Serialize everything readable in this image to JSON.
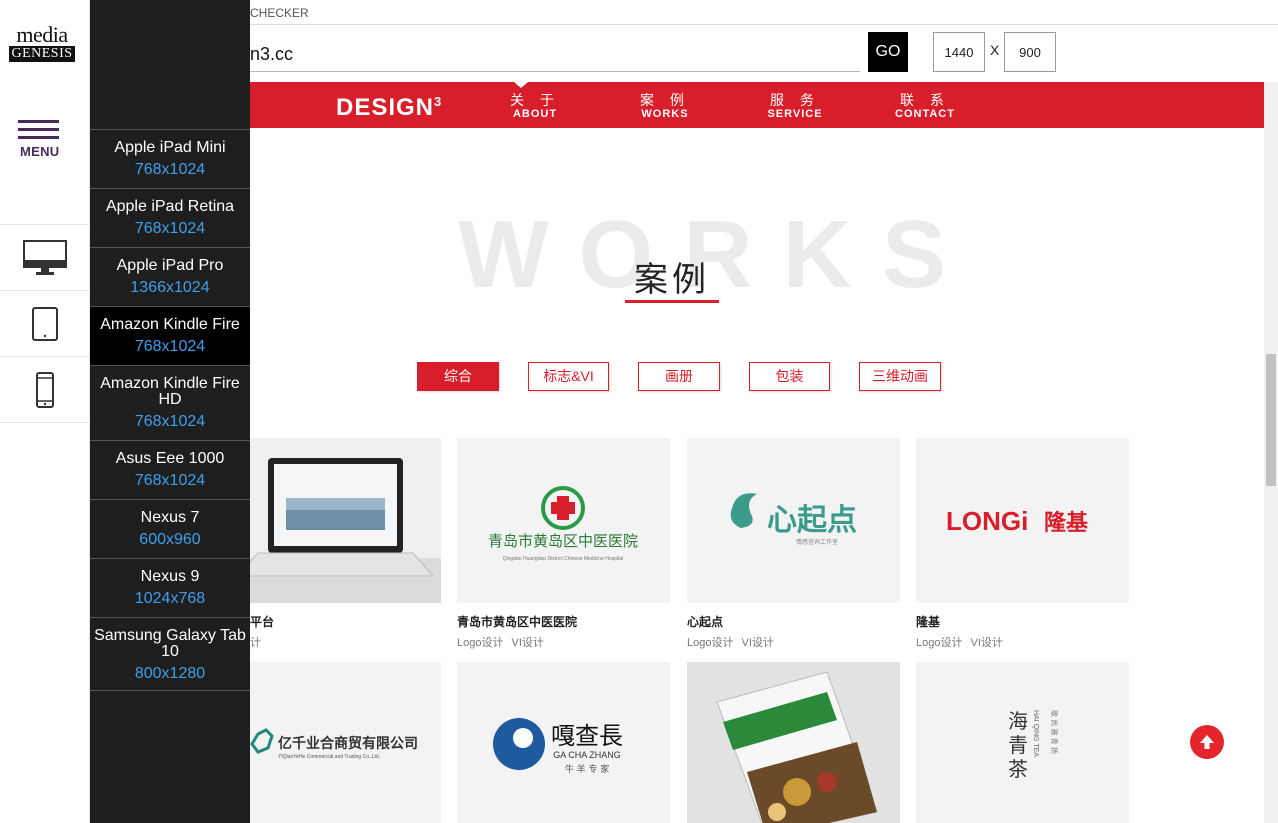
{
  "rail": {
    "logo_line1": "media",
    "logo_line2": "GENESIS",
    "menu_label": "MENU"
  },
  "devices": [
    {
      "name": "Apple iPad Mini",
      "size": "768x1024",
      "active": false
    },
    {
      "name": "Apple iPad Retina",
      "size": "768x1024",
      "active": false
    },
    {
      "name": "Apple iPad Pro",
      "size": "1366x1024",
      "active": false
    },
    {
      "name": "Amazon Kindle Fire",
      "size": "768x1024",
      "active": true
    },
    {
      "name": "Amazon Kindle Fire HD",
      "size": "768x1024",
      "active": false
    },
    {
      "name": "Asus Eee 1000",
      "size": "768x1024",
      "active": false
    },
    {
      "name": "Nexus 7",
      "size": "600x960",
      "active": false
    },
    {
      "name": "Nexus 9",
      "size": "1024x768",
      "active": false
    },
    {
      "name": "Samsung Galaxy Tab 10",
      "size": "800x1280",
      "active": false
    }
  ],
  "toolbar": {
    "checker_label": "CHECKER",
    "url_value": "n3.cc",
    "go_label": "GO",
    "width_value": "1440",
    "x_label": "X",
    "height_value": "900"
  },
  "site": {
    "brand": "DESIGN",
    "brand_sup": "3",
    "nav": [
      {
        "zh": "关 于",
        "en": "ABOUT"
      },
      {
        "zh": "案 例",
        "en": "WORKS"
      },
      {
        "zh": "服 务",
        "en": "SERVICE"
      },
      {
        "zh": "联 系",
        "en": "CONTACT"
      }
    ],
    "bg_title": "WORKS",
    "section_title": "案例",
    "filters": [
      "综合",
      "标志&VI",
      "画册",
      "包装",
      "三维动画"
    ],
    "cards_row1": [
      {
        "title": "平台",
        "tags": [
          "计"
        ]
      },
      {
        "title": "青岛市黄岛区中医医院",
        "tags": [
          "Logo设计",
          "VI设计"
        ]
      },
      {
        "title": "心起点",
        "tags": [
          "Logo设计",
          "VI设计"
        ]
      },
      {
        "title": "隆基",
        "tags": [
          "Logo设计",
          "VI设计"
        ]
      }
    ],
    "thumb_texts": {
      "hospital_zh": "青岛市黄岛区中医医院",
      "hospital_en": "Qingdao Huangdao District Chinese Medicine Hospital",
      "xinqidian": "心起点",
      "xinqidian_sub": "情感咨询工作室",
      "longi_en": "LONGi",
      "longi_zh": "隆基",
      "yiqian": "亿千业合商贸有限公司",
      "yiqian_en": "YIQianYeHe Commercial and Trading Co.,Ltd.",
      "gachazhang": "嘎查長",
      "gachazhang_en": "GA CHA ZHANG",
      "gachazhang_sub": "牛 羊 专 家",
      "tea": "海青茶",
      "tea_en": "HAI QING TEA",
      "tea_side": "歌 尚 雅 青 扬"
    }
  },
  "colors": {
    "brand_red": "#d71e2a",
    "panel_bg": "#1e1e1e",
    "size_blue": "#3ea0ea",
    "menu_purple": "#4a2a5a"
  }
}
